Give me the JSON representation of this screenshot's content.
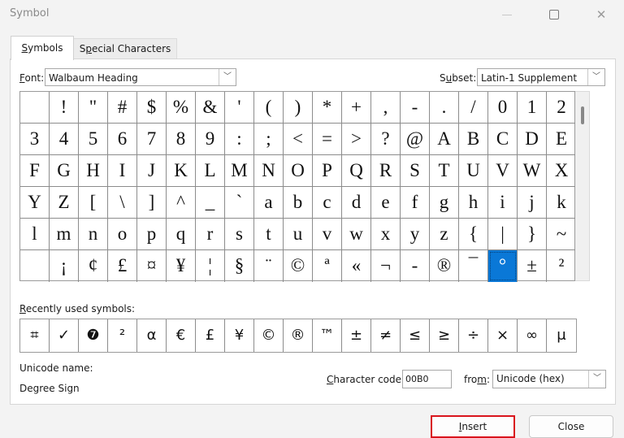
{
  "window": {
    "title": "Symbol",
    "controls": {
      "minimize": "–",
      "maximize": "▢",
      "close": "✕"
    }
  },
  "tabs": [
    {
      "label": "Symbols",
      "accel": "S",
      "rest": "ymbols",
      "active": true
    },
    {
      "label": "Special Characters",
      "accel": "p",
      "pre": "S",
      "rest": "ecial Characters",
      "active": false
    }
  ],
  "font": {
    "accel": "F",
    "label_rest": "ont:",
    "value": "Walbaum Heading"
  },
  "subset": {
    "pre": "S",
    "accel": "u",
    "label_rest": "bset:",
    "value": "Latin-1 Supplement"
  },
  "symbol_grid": {
    "rows": [
      [
        "",
        "!",
        "\"",
        "#",
        "$",
        "%",
        "&",
        "'",
        "(",
        ")",
        "*",
        "+",
        ",",
        "-",
        ".",
        "/",
        "0",
        "1",
        "2"
      ],
      [
        "3",
        "4",
        "5",
        "6",
        "7",
        "8",
        "9",
        ":",
        ";",
        "<",
        "=",
        ">",
        "?",
        "@",
        "A",
        "B",
        "C",
        "D",
        "E"
      ],
      [
        "F",
        "G",
        "H",
        "I",
        "J",
        "K",
        "L",
        "M",
        "N",
        "O",
        "P",
        "Q",
        "R",
        "S",
        "T",
        "U",
        "V",
        "W",
        "X"
      ],
      [
        "Y",
        "Z",
        "[",
        "\\",
        "]",
        "^",
        "_",
        "`",
        "a",
        "b",
        "c",
        "d",
        "e",
        "f",
        "g",
        "h",
        "i",
        "j",
        "k"
      ],
      [
        "l",
        "m",
        "n",
        "o",
        "p",
        "q",
        "r",
        "s",
        "t",
        "u",
        "v",
        "w",
        "x",
        "y",
        "z",
        "{",
        "|",
        "}",
        "~"
      ],
      [
        "",
        "¡",
        "¢",
        "£",
        "¤",
        "¥",
        "¦",
        "§",
        "¨",
        "©",
        "ª",
        "«",
        "¬",
        "-",
        "®",
        "¯",
        "°",
        "±",
        "²"
      ]
    ],
    "selected": {
      "row": 5,
      "col": 16
    }
  },
  "recently_used": {
    "accel": "R",
    "label_rest": "ecently used symbols:",
    "symbols": [
      "⌗",
      "✓",
      "❼",
      "²",
      "α",
      "€",
      "£",
      "¥",
      "©",
      "®",
      "™",
      "±",
      "≠",
      "≤",
      "≥",
      "÷",
      "×",
      "∞",
      "μ"
    ]
  },
  "unicode_name": {
    "label": "Unicode name:",
    "value": "Degree Sign"
  },
  "character_code": {
    "accel": "C",
    "label_rest": "haracter code:",
    "value": "00B0"
  },
  "from": {
    "pre": "fro",
    "accel": "m",
    "label_rest": ":",
    "value": "Unicode (hex)"
  },
  "buttons": {
    "insert": {
      "accel": "I",
      "rest": "nsert"
    },
    "close": {
      "label": "Close"
    }
  }
}
